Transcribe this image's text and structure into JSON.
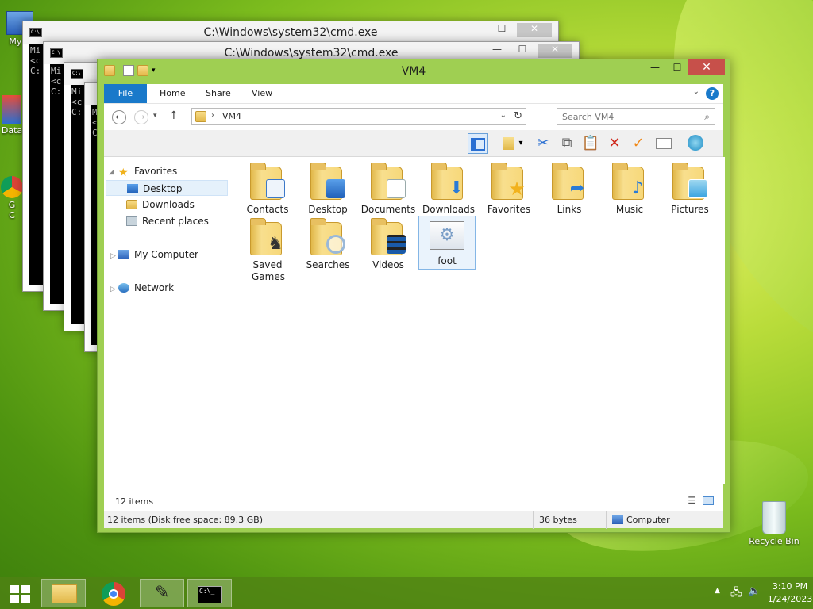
{
  "desktop": {
    "icons": [
      {
        "label": "My C",
        "name": "my-computer"
      },
      {
        "label": "Data",
        "name": "data"
      },
      {
        "label": "G\nC",
        "name": "google-chrome"
      },
      {
        "label": "Recycle Bin",
        "name": "recycle-bin"
      }
    ]
  },
  "cmd_windows": [
    {
      "title": "C:\\Windows\\system32\\cmd.exe",
      "lines": [
        "Mi",
        "<c",
        "",
        "C:"
      ]
    },
    {
      "title": "C:\\Windows\\system32\\cmd.exe",
      "lines": [
        "Mi",
        "<c",
        "",
        "C:"
      ]
    },
    {
      "title": "",
      "lines": [
        "Mi",
        "<c",
        "",
        "C:"
      ]
    },
    {
      "title": "",
      "lines": [
        "Mi",
        "<c",
        "",
        "C:"
      ]
    }
  ],
  "explorer": {
    "title": "VM4",
    "tabs": {
      "file": "File",
      "home": "Home",
      "share": "Share",
      "view": "View"
    },
    "address": {
      "path": "VM4"
    },
    "search": {
      "placeholder": "Search VM4"
    },
    "nav": {
      "favorites": "Favorites",
      "desktop": "Desktop",
      "downloads": "Downloads",
      "recent": "Recent places",
      "my_computer": "My Computer",
      "network": "Network"
    },
    "items": [
      {
        "label": "Contacts",
        "overlay": "contact-card",
        "color": "#3c78c8"
      },
      {
        "label": "Desktop",
        "overlay": "screen",
        "color": "#2a6fd2"
      },
      {
        "label": "Documents",
        "overlay": "pages",
        "color": "#ffffff"
      },
      {
        "label": "Downloads",
        "overlay": "down-arrow",
        "color": "#2a7bd6"
      },
      {
        "label": "Favorites",
        "overlay": "star",
        "color": "#f2b21d"
      },
      {
        "label": "Links",
        "overlay": "link-arrow",
        "color": "#2a7bd6"
      },
      {
        "label": "Music",
        "overlay": "music-note",
        "color": "#2a7bd6"
      },
      {
        "label": "Pictures",
        "overlay": "photo",
        "color": "#3aa3e0"
      },
      {
        "label": "Saved Games",
        "overlay": "chess-pieces",
        "color": "#444444"
      },
      {
        "label": "Searches",
        "overlay": "magnifier",
        "color": "#9ab8d8"
      },
      {
        "label": "Videos",
        "overlay": "film",
        "color": "#1a5aa8"
      },
      {
        "label": "foot",
        "overlay": "gear-window",
        "color": "#7a9ec7"
      }
    ],
    "item_count": "12 items",
    "status": {
      "summary": "12 items (Disk free space: 89.3 GB)",
      "size": "36 bytes",
      "location": "Computer"
    }
  },
  "taskbar": {
    "time": "3:10 PM",
    "date": "1/24/2023"
  }
}
